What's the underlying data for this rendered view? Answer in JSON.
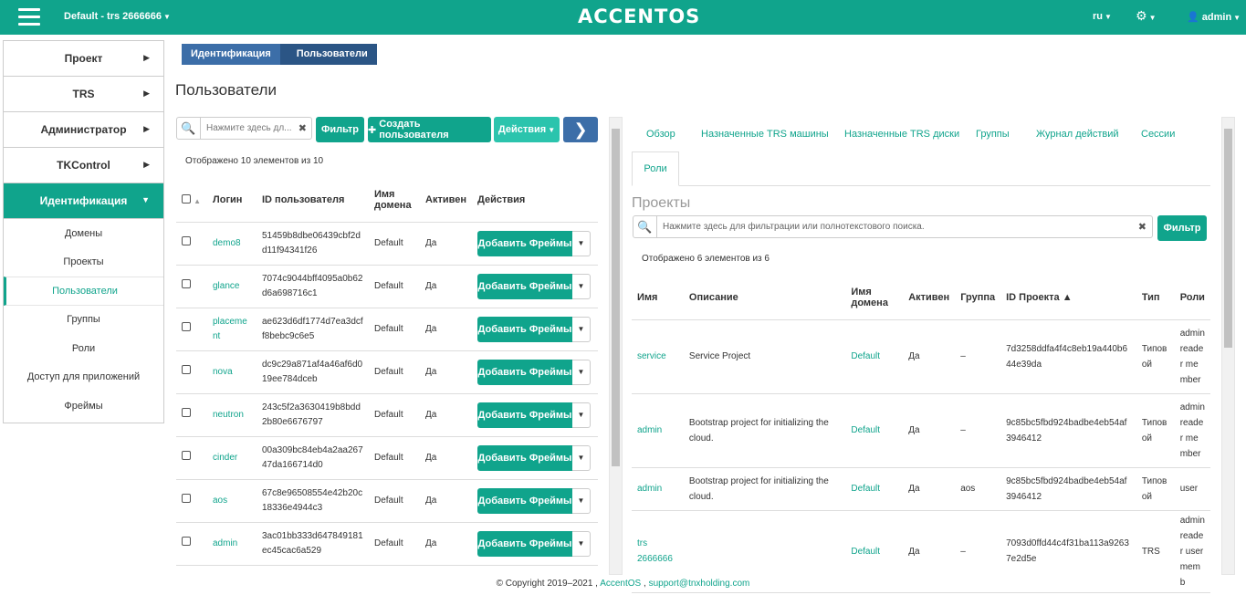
{
  "topbar": {
    "project": "Default - trs 2666666",
    "logo": "ACCENTOS",
    "lang": "ru",
    "user": "admin"
  },
  "sidebar": {
    "items": [
      {
        "label": "Проект"
      },
      {
        "label": "TRS"
      },
      {
        "label": "Администратор"
      },
      {
        "label": "TKControl"
      },
      {
        "label": "Идентификация"
      }
    ],
    "subitems": [
      {
        "label": "Домены"
      },
      {
        "label": "Проекты"
      },
      {
        "label": "Пользователи"
      },
      {
        "label": "Группы"
      },
      {
        "label": "Роли"
      },
      {
        "label": "Доступ для приложений"
      },
      {
        "label": "Фреймы"
      }
    ]
  },
  "breadcrumb": {
    "first": "Идентификация",
    "second": "Пользователи"
  },
  "page_title": "Пользователи",
  "users": {
    "search_placeholder": "Нажмите здесь дл...",
    "filter_label": "Фильтр",
    "create_label": "Создать пользователя",
    "actions_label": "Действия",
    "count_text": "Отображено 10 элементов из 10",
    "columns": {
      "login": "Логин",
      "id": "ID пользователя",
      "domain": "Имя домена",
      "active": "Активен",
      "actions": "Действия"
    },
    "row_button": "Добавить Фреймы",
    "rows": [
      {
        "login": "demo8",
        "id": "51459b8dbe06439cbf2dd11f94341f26",
        "domain": "Default",
        "active": "Да"
      },
      {
        "login": "glance",
        "id": "7074c9044bff4095a0b62d6a698716c1",
        "domain": "Default",
        "active": "Да"
      },
      {
        "login": "placement",
        "id": "ae623d6df1774d7ea3dcff8bebc9c6e5",
        "domain": "Default",
        "active": "Да"
      },
      {
        "login": "nova",
        "id": "dc9c29a871af4a46af6d019ee784dceb",
        "domain": "Default",
        "active": "Да"
      },
      {
        "login": "neutron",
        "id": "243c5f2a3630419b8bdd2b80e6676797",
        "domain": "Default",
        "active": "Да"
      },
      {
        "login": "cinder",
        "id": "00a309bc84eb4a2aa26747da166714d0",
        "domain": "Default",
        "active": "Да"
      },
      {
        "login": "aos",
        "id": "67c8e96508554e42b20c18336e4944c3",
        "domain": "Default",
        "active": "Да"
      },
      {
        "login": "admin",
        "id": "3ac01bb333d647849181ec45cac6a529",
        "domain": "Default",
        "active": "Да"
      }
    ]
  },
  "detail": {
    "tabs": [
      "Обзор",
      "Назначенные TRS машины",
      "Назначенные TRS диски",
      "Группы",
      "Журнал действий",
      "Сессии",
      "Роли"
    ],
    "section_title": "Проекты",
    "search_placeholder": "Нажмите здесь для фильтрации или полнотекстового поиска.",
    "filter_label": "Фильтр",
    "count_text": "Отображено 6 элементов из 6",
    "columns": {
      "name": "Имя",
      "desc": "Описание",
      "domain": "Имя домена",
      "active": "Активен",
      "group": "Группа",
      "pid": "ID Проекта ▲",
      "type": "Тип",
      "roles": "Роли"
    },
    "rows": [
      {
        "name": "service",
        "desc": "Service Project",
        "domain": "Default",
        "active": "Да",
        "group": "–",
        "pid": "7d3258ddfa4f4c8eb19a440b644e39da",
        "type": "Типовой",
        "roles": "admin reader member"
      },
      {
        "name": "admin",
        "desc": "Bootstrap project for initializing the cloud.",
        "domain": "Default",
        "active": "Да",
        "group": "–",
        "pid": "9c85bc5fbd924badbe4eb54af3946412",
        "type": "Типовой",
        "roles": "admin reader member"
      },
      {
        "name": "admin",
        "desc": "Bootstrap project for initializing the cloud.",
        "domain": "Default",
        "active": "Да",
        "group": "aos",
        "pid": "9c85bc5fbd924badbe4eb54af3946412",
        "type": "Типовой",
        "roles": "user"
      },
      {
        "name": "trs 2666666",
        "desc": "",
        "domain": "Default",
        "active": "Да",
        "group": "–",
        "pid": "7093d0ffd44c4f31ba113a92637e2d5e",
        "type": "TRS",
        "roles": "admin reader user memb"
      }
    ]
  },
  "footer": {
    "copyright": "© Copyright 2019–2021 ,",
    "link1": "AccentOS",
    "sep": ",",
    "link2": "support@tnxholding.com"
  }
}
